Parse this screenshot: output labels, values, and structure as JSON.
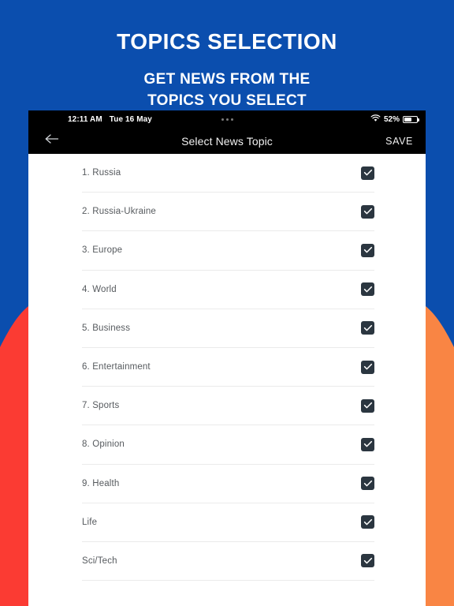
{
  "promo": {
    "title": "TOPICS SELECTION",
    "subtitle_line1": "GET NEWS FROM THE",
    "subtitle_line2": "TOPICS YOU SELECT"
  },
  "colors": {
    "background_blue": "#0b4eae",
    "accent_red": "#fb3b33",
    "accent_orange": "#f98544",
    "checkbox_dark": "#2b3640",
    "app_bar_black": "#000000"
  },
  "status_bar": {
    "time": "12:11 AM",
    "date": "Tue 16 May",
    "battery_percent": "52%",
    "wifi_icon": "wifi-icon",
    "battery_icon": "battery-icon",
    "center_dots": "three-dots-indicator"
  },
  "nav_bar": {
    "back_icon": "back-arrow-icon",
    "title": "Select News Topic",
    "save_label": "SAVE"
  },
  "topics": [
    {
      "label": "1. Russia",
      "checked": true
    },
    {
      "label": "2. Russia-Ukraine",
      "checked": true
    },
    {
      "label": "3. Europe",
      "checked": true
    },
    {
      "label": "4. World",
      "checked": true
    },
    {
      "label": "5. Business",
      "checked": true
    },
    {
      "label": "6. Entertainment",
      "checked": true
    },
    {
      "label": "7. Sports",
      "checked": true
    },
    {
      "label": "8. Opinion",
      "checked": true
    },
    {
      "label": "9. Health",
      "checked": true
    },
    {
      "label": "Life",
      "checked": true
    },
    {
      "label": "Sci/Tech",
      "checked": true
    }
  ]
}
